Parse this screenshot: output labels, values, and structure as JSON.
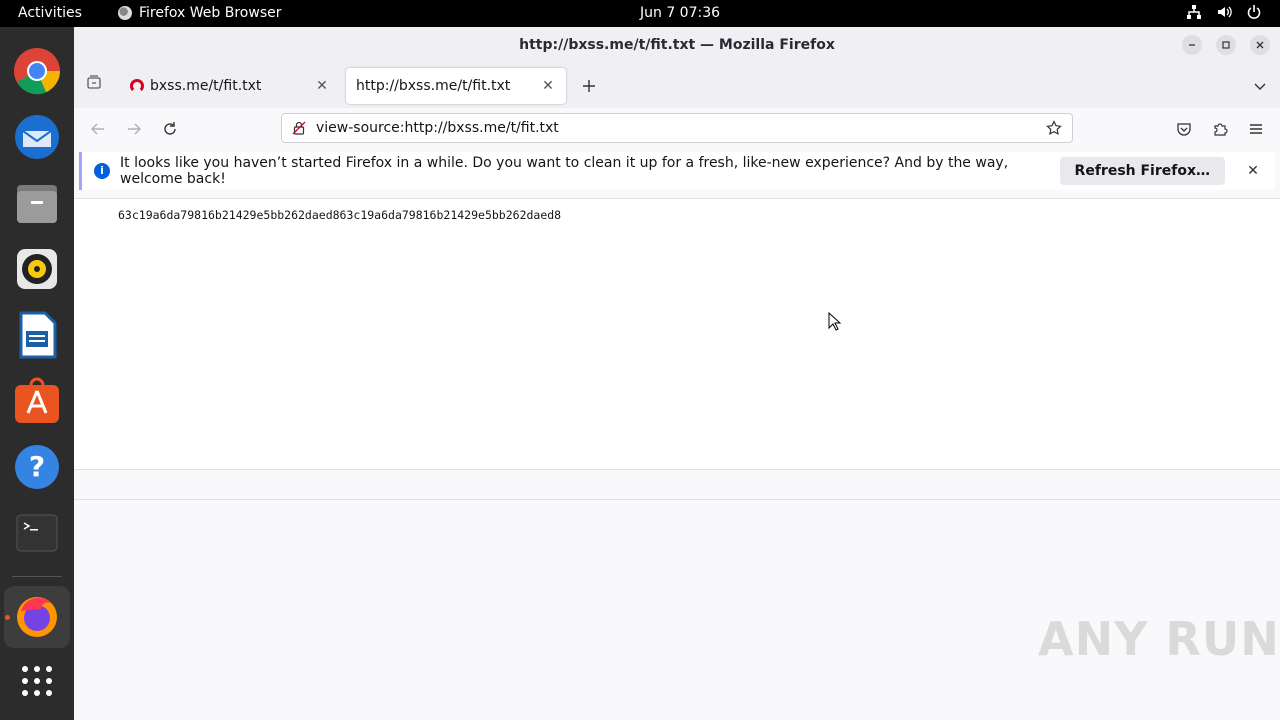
{
  "topbar": {
    "activities": "Activities",
    "app_name": "Firefox Web Browser",
    "clock": "Jun 7  07:36"
  },
  "dock": {
    "apps": [
      "chrome-icon",
      "thunderbird-icon",
      "files-icon",
      "rhythmbox-icon",
      "writer-icon",
      "software-icon",
      "help-icon",
      "terminal-icon",
      "firefox-icon",
      "app-grid-icon"
    ]
  },
  "window": {
    "title": "http://bxss.me/t/fit.txt — Mozilla Firefox"
  },
  "tabs": [
    {
      "label": "bxss.me/t/fit.txt"
    },
    {
      "label": "http://bxss.me/t/fit.txt"
    }
  ],
  "urlbar": {
    "value": "view-source:http://bxss.me/t/fit.txt"
  },
  "notification": {
    "message": "It looks like you haven’t started Firefox in a while. Do you want to clean it up for a fresh, like-new experience? And by the way, welcome back!",
    "button": "Refresh Firefox…"
  },
  "content": {
    "source_text": "63c19a6da79816b21429e5bb262daed863c19a6da79816b21429e5bb262daed8"
  },
  "watermark": "ANY RUN",
  "colors": {
    "topbar": "#000000",
    "dock": "#2c2c2c",
    "accent": "#0060df",
    "notification_border": "#a3a3ff"
  }
}
